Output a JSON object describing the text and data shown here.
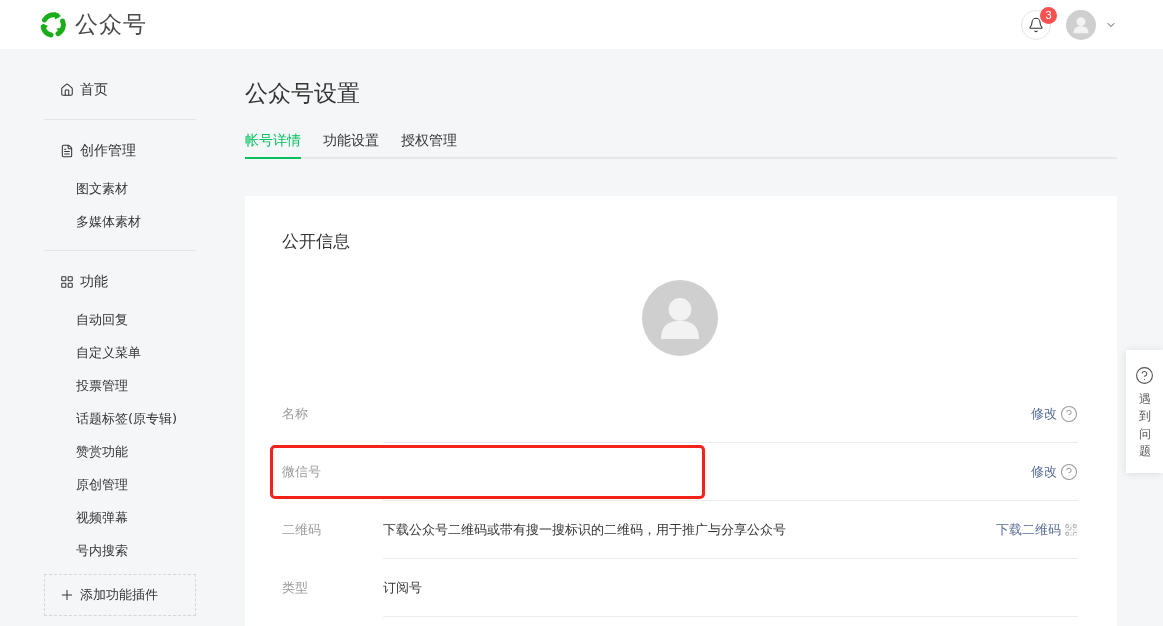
{
  "header": {
    "title": "公众号",
    "notifications": {
      "count": "3"
    }
  },
  "sidebar": {
    "groups": [
      {
        "label": "首页"
      },
      {
        "label": "创作管理",
        "items": [
          "图文素材",
          "多媒体素材"
        ]
      },
      {
        "label": "功能",
        "items": [
          "自动回复",
          "自定义菜单",
          "投票管理",
          "话题标签(原专辑)",
          "赞赏功能",
          "原创管理",
          "视频弹幕",
          "号内搜索"
        ]
      }
    ],
    "add_plugin_button": "添加功能插件"
  },
  "page": {
    "title": "公众号设置",
    "tabs": [
      {
        "label": "帐号详情",
        "selected": true
      },
      {
        "label": "功能设置",
        "selected": false
      },
      {
        "label": "授权管理",
        "selected": false
      }
    ]
  },
  "card": {
    "title": "公开信息",
    "rows": [
      {
        "label": "名称",
        "action": {
          "label": "修改",
          "kind": "help"
        },
        "highlighted": false
      },
      {
        "label": "微信号",
        "action": {
          "label": "修改",
          "kind": "help"
        },
        "highlighted": true
      },
      {
        "label": "二维码",
        "value": "下载公众号二维码或带有搜一搜标识的二维码，用于推广与分享公众号",
        "action": {
          "label": "下载二维码",
          "kind": "qr"
        },
        "highlighted": false
      },
      {
        "label": "类型",
        "value": "订阅号",
        "highlighted": false
      }
    ]
  },
  "help_tab": {
    "label": "遇到问题"
  }
}
